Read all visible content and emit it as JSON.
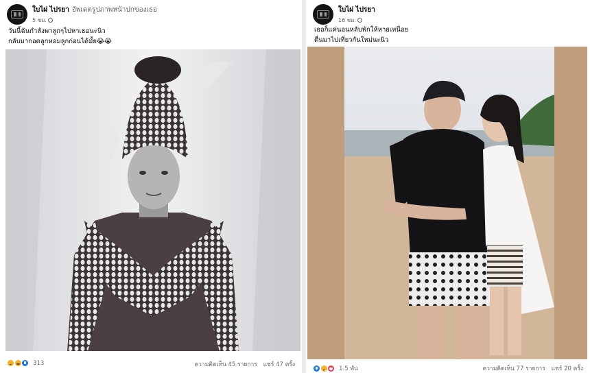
{
  "posts": [
    {
      "author": "ใบไผ่ ไปรยา",
      "action": "อัพเดตรูปภาพหน้าปกของเธอ",
      "time": "5 ชม.",
      "caption_lines": [
        "วันนี้ฉันกำลังพาลูกๆไปหาเธอนะนิว",
        "กลับมากอดลูกหอมลูกก่อนได้มั้ย😭😭"
      ],
      "photo_icon": "monochrome-dance-costume-portrait",
      "reaction_icons": [
        "sad-reaction-icon",
        "haha-reaction-icon",
        "like-reaction-icon"
      ],
      "reaction_count": "313",
      "comments": "ความคิดเห็น 45 รายการ",
      "shares": "แชร์ 47 ครั้ง"
    },
    {
      "author": "ใบไผ่ ไปรยา",
      "action": "",
      "time": "16 ชม.",
      "caption_lines": [
        "เธอก็แค่นอนหลับพักให้หายเหนื่อย",
        "ตื่นมาไปเที่ยวกันใหม่นะนิว"
      ],
      "photo_icon": "beach-couple-photo",
      "reaction_icons": [
        "like-reaction-icon",
        "sad-reaction-icon",
        "love-reaction-icon"
      ],
      "reaction_count": "1.5 พัน",
      "comments": "ความคิดเห็น 77 รายการ",
      "shares": "แชร์ 20 ครั้ง"
    }
  ],
  "colors": {
    "page_bg": "#e9ebee",
    "card_bg": "#ffffff",
    "text": "#050505",
    "meta_text": "#65676b",
    "photo_right_bg": "#bf9d7d"
  }
}
